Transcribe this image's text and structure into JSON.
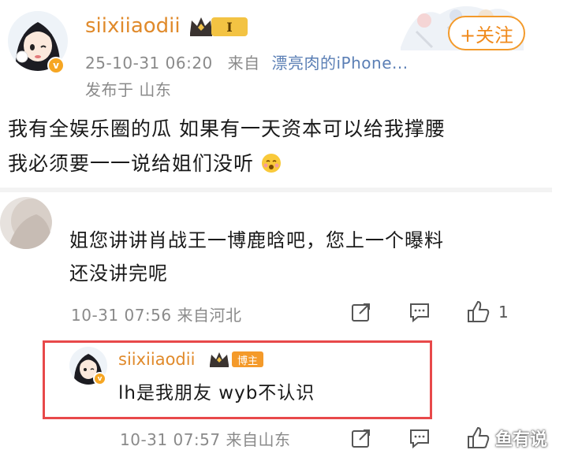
{
  "post": {
    "username": "siixiiaodii",
    "level_badge": "I",
    "timestamp": "25-10-31 06:20",
    "source_prefix": "来自",
    "source": "漂亮肉的iPhone...",
    "location": "发布于 山东",
    "follow_label": "+关注",
    "text_line1": "我有全娱乐圈的瓜 如果有一天资本可以给我撑腰",
    "text_line2": "我必须要一一说给姐们没听"
  },
  "comment": {
    "text_line1": "姐您讲讲肖战王一博鹿晗吧，您上一个曝料",
    "text_line2": "还没讲完呢",
    "meta": "10-31 07:56  来自河北",
    "like_count": "1"
  },
  "reply": {
    "username": "siixiiaodii",
    "badge": "博主",
    "text": "lh是我朋友 wyb不认识",
    "meta": "10-31 07:57  来自山东"
  },
  "watermark": "鱼有说",
  "colors": {
    "username": "#e08a2b",
    "follow": "#f08a1c",
    "highlight": "#e8494a",
    "source_link": "#5b7fb5"
  }
}
